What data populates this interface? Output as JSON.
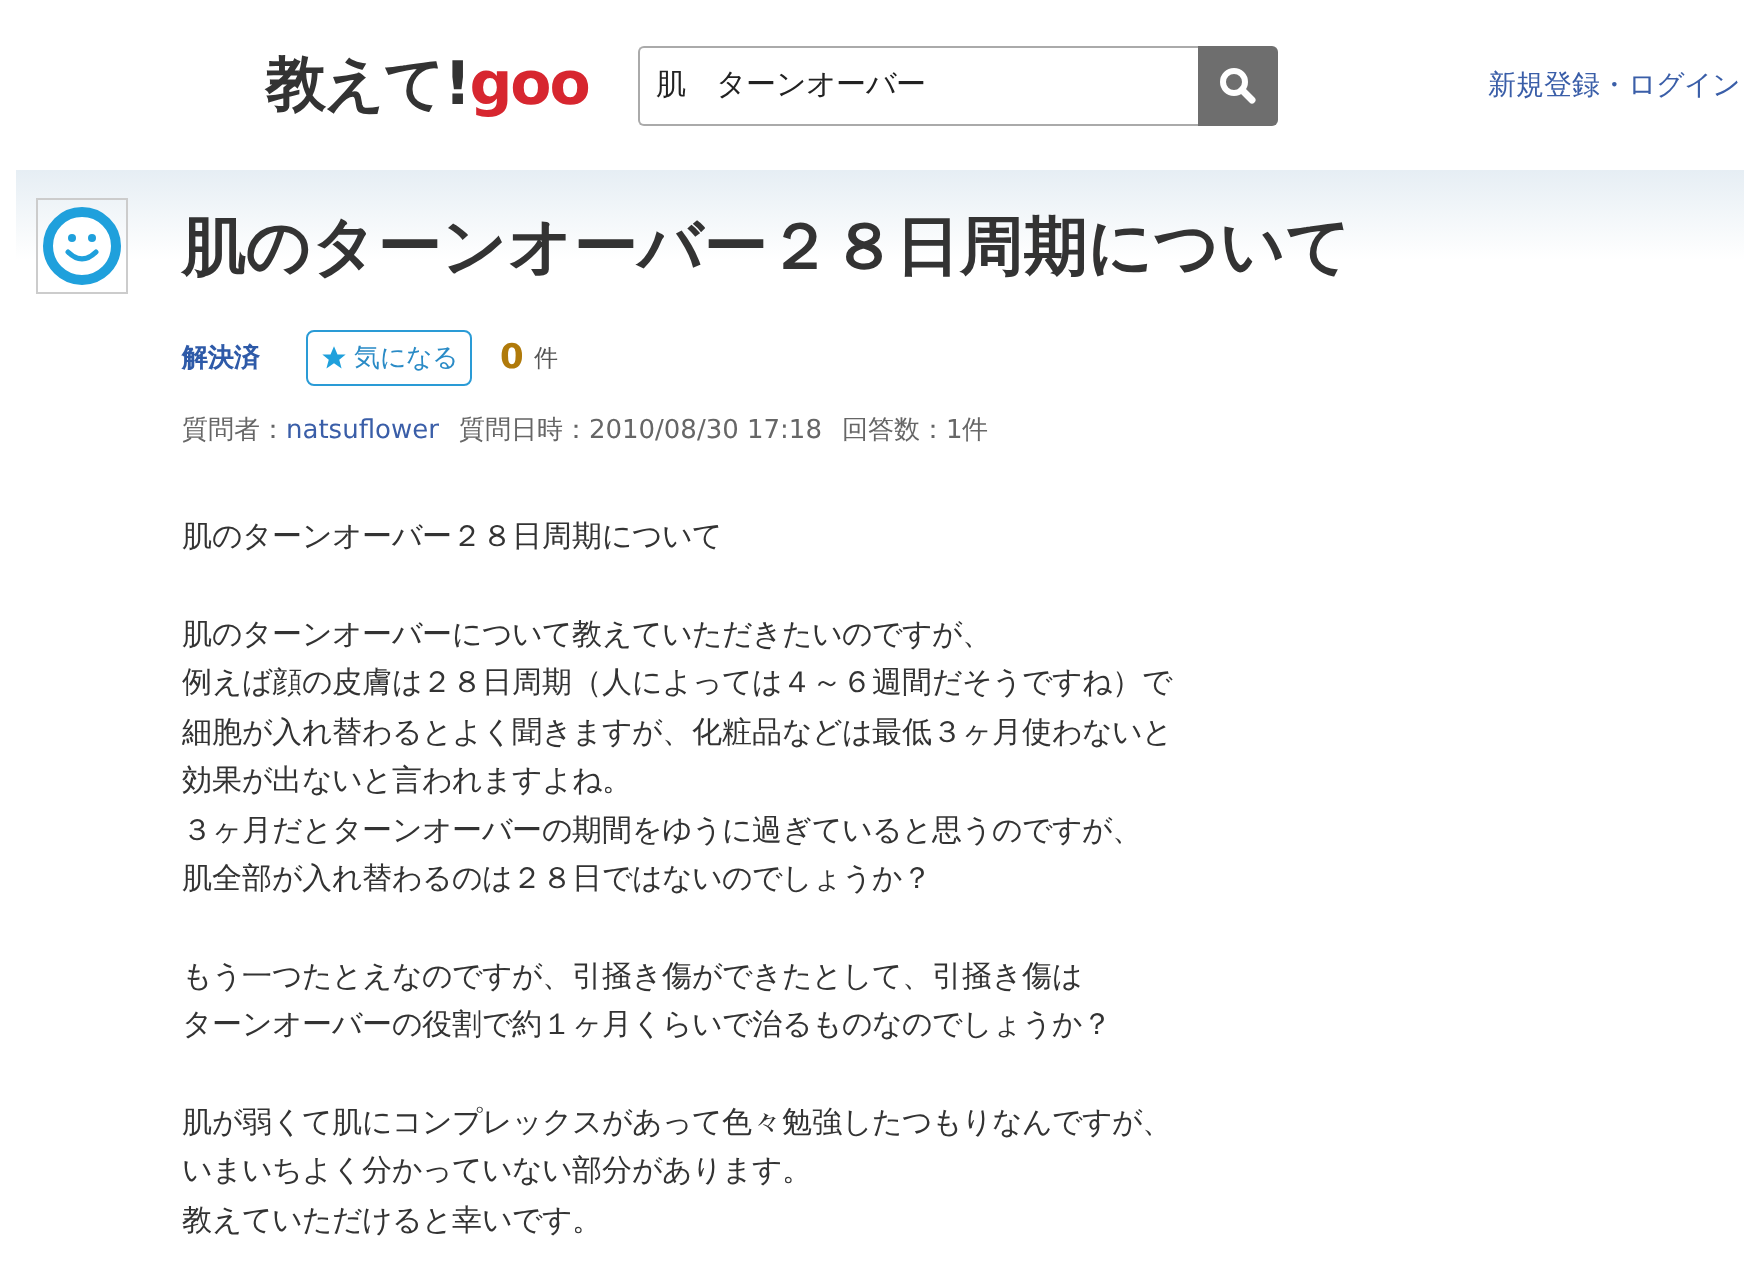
{
  "header": {
    "logo": {
      "prefix": "教えて!",
      "brand": "goo"
    },
    "search": {
      "value": "肌　ターンオーバー"
    },
    "login_link": "新規登録・ログイン"
  },
  "question": {
    "title": "肌のターンオーバー２８日周期について",
    "status": "解決済",
    "watch_button": "気になる",
    "watch_count": "0",
    "watch_unit": "件",
    "meta": [
      {
        "label": "質問者：",
        "value": "natsuflower",
        "kind": "link"
      },
      {
        "label": "質問日時：",
        "value": "2010/08/30 17:18",
        "kind": "text"
      },
      {
        "label": "回答数：",
        "value": "1件",
        "kind": "text"
      }
    ],
    "body": [
      [
        "肌のターンオーバー２８日周期について"
      ],
      [
        "肌のターンオーバーについて教えていただきたいのですが、",
        "例えば顔の皮膚は２８日周期（人によっては４～６週間だそうですね）で",
        "細胞が入れ替わるとよく聞きますが、化粧品などは最低３ヶ月使わないと",
        "効果が出ないと言われますよね。",
        "３ヶ月だとターンオーバーの期間をゆうに過ぎていると思うのですが、",
        "肌全部が入れ替わるのは２８日ではないのでしょうか？"
      ],
      [
        "もう一つたとえなのですが、引掻き傷ができたとして、引掻き傷は",
        "ターンオーバーの役割で約１ヶ月くらいで治るものなのでしょうか？"
      ],
      [
        "肌が弱くて肌にコンプレックスがあって色々勉強したつもりなんですが、",
        "いまいちよく分かっていない部分があります。",
        "教えていただけると幸いです。"
      ]
    ]
  }
}
